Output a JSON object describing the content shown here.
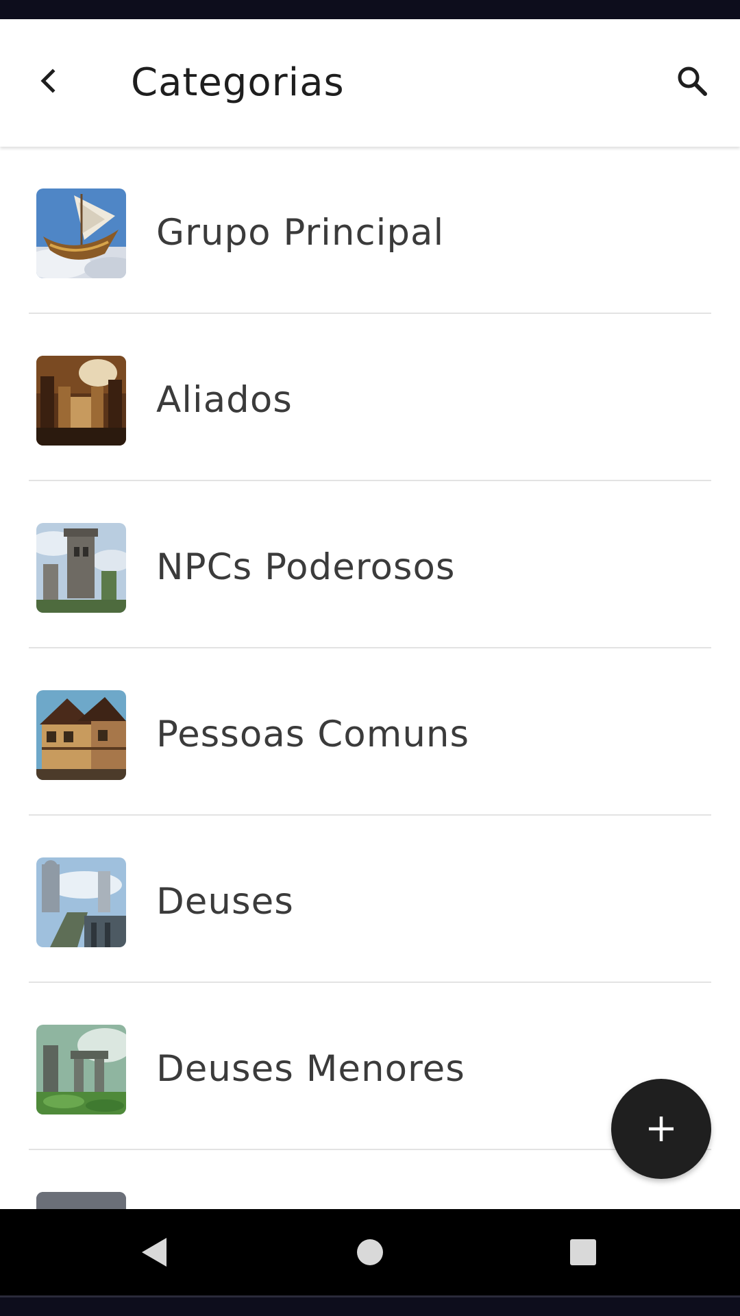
{
  "app_bar": {
    "title": "Categorias",
    "back_icon": "back-arrow-icon",
    "search_icon": "search-icon"
  },
  "categories": [
    {
      "label": "Grupo Principal",
      "thumbnail": "flying-ship-thumbnail"
    },
    {
      "label": "Aliados",
      "thumbnail": "library-hall-thumbnail"
    },
    {
      "label": "NPCs Poderosos",
      "thumbnail": "castle-tower-thumbnail"
    },
    {
      "label": "Pessoas Comuns",
      "thumbnail": "timber-house-thumbnail"
    },
    {
      "label": "Deuses",
      "thumbnail": "statue-bridge-thumbnail"
    },
    {
      "label": "Deuses Menores",
      "thumbnail": "stone-ruins-thumbnail"
    },
    {
      "label": "",
      "thumbnail": "partial-thumbnail"
    }
  ],
  "fab": {
    "icon": "plus-icon"
  },
  "navigation": {
    "back_icon": "nav-back-icon",
    "home_icon": "nav-home-icon",
    "recents_icon": "nav-recents-icon"
  },
  "colors": {
    "status_bar": "#0d0d1c",
    "title_text": "#1e1e1e",
    "item_text": "#3b3b3b",
    "divider": "#e3e3e3",
    "fab": "#1f1f1f",
    "nav_bar": "#000000",
    "nav_icon": "#d9d9d9"
  }
}
